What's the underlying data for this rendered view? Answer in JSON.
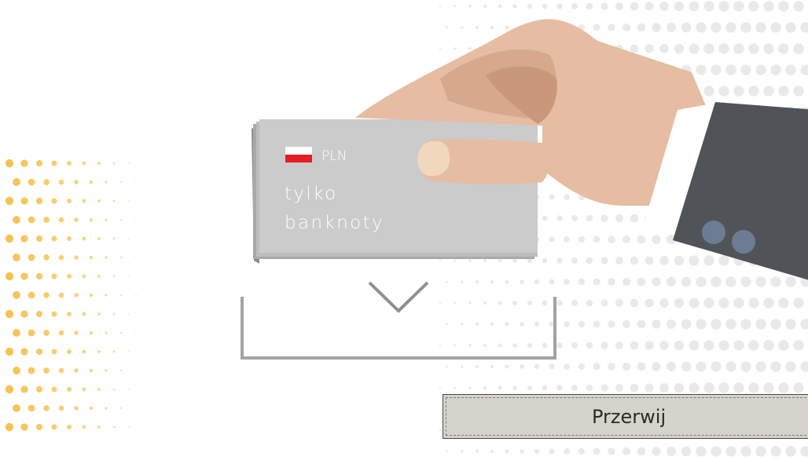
{
  "banknote": {
    "currency": "PLN",
    "line1": "tylko",
    "line2": "banknoty"
  },
  "actions": {
    "cancel_label": "Przerwij"
  },
  "colors": {
    "dots_right": "#e9e9e9",
    "dots_left": "#f5c04a",
    "note": "#cccccc",
    "skin": "#e6bda2",
    "sleeve": "#505458",
    "button_bg": "#d6d3cc"
  },
  "icons": {
    "slot_arrow": "chevron-down-icon",
    "flag": "poland-flag-icon"
  }
}
